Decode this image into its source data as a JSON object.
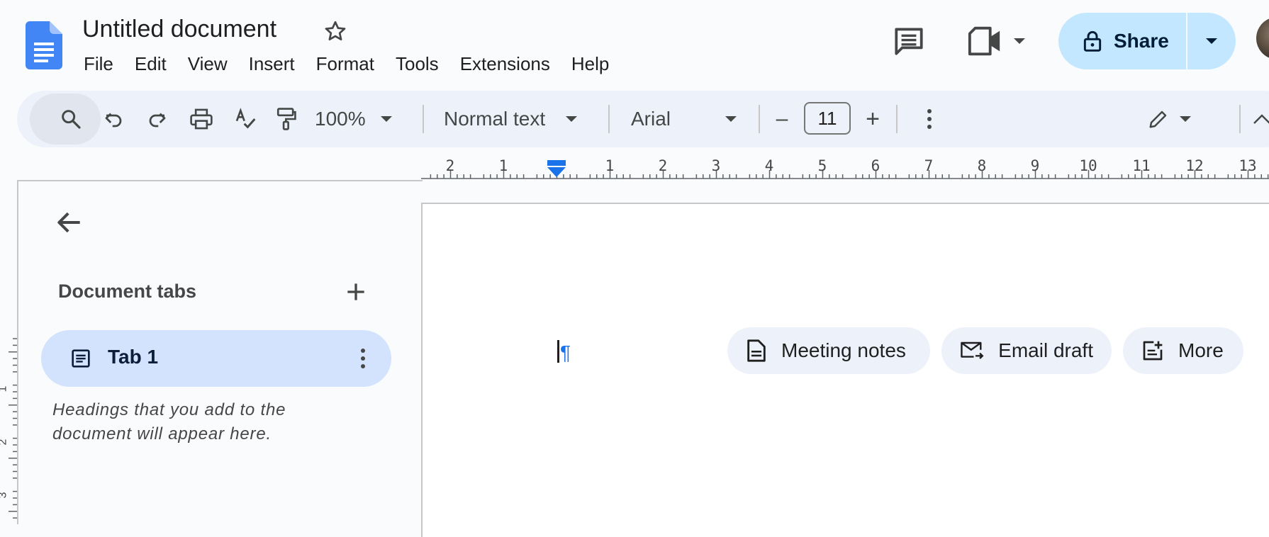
{
  "header": {
    "title": "Untitled document",
    "menus": [
      "File",
      "Edit",
      "View",
      "Insert",
      "Format",
      "Tools",
      "Extensions",
      "Help"
    ],
    "share_label": "Share"
  },
  "toolbar": {
    "zoom": "100%",
    "paragraph_style": "Normal text",
    "font": "Arial",
    "font_size": "11",
    "minus": "–",
    "plus": "+"
  },
  "ruler": {
    "labels": [
      "2",
      "1",
      "1",
      "2",
      "3",
      "4",
      "5",
      "6",
      "7",
      "8",
      "9",
      "10",
      "11",
      "12",
      "13"
    ],
    "vertical_labels": [
      "1",
      "2",
      "3"
    ]
  },
  "sidebar": {
    "heading": "Document tabs",
    "tabs": [
      {
        "label": "Tab 1"
      }
    ],
    "hint": "Headings that you add to the document will appear here."
  },
  "page": {
    "paragraph_mark": "¶",
    "chips": [
      {
        "label": "Meeting notes",
        "icon": "document-icon"
      },
      {
        "label": "Email draft",
        "icon": "email-send-icon"
      },
      {
        "label": "More",
        "icon": "note-add-icon"
      }
    ]
  },
  "colors": {
    "background": "#f9fbfd",
    "toolbar": "#edf2fa",
    "share": "#c2e7ff",
    "active_tab": "#d3e3fd",
    "accent": "#1a73e8"
  }
}
